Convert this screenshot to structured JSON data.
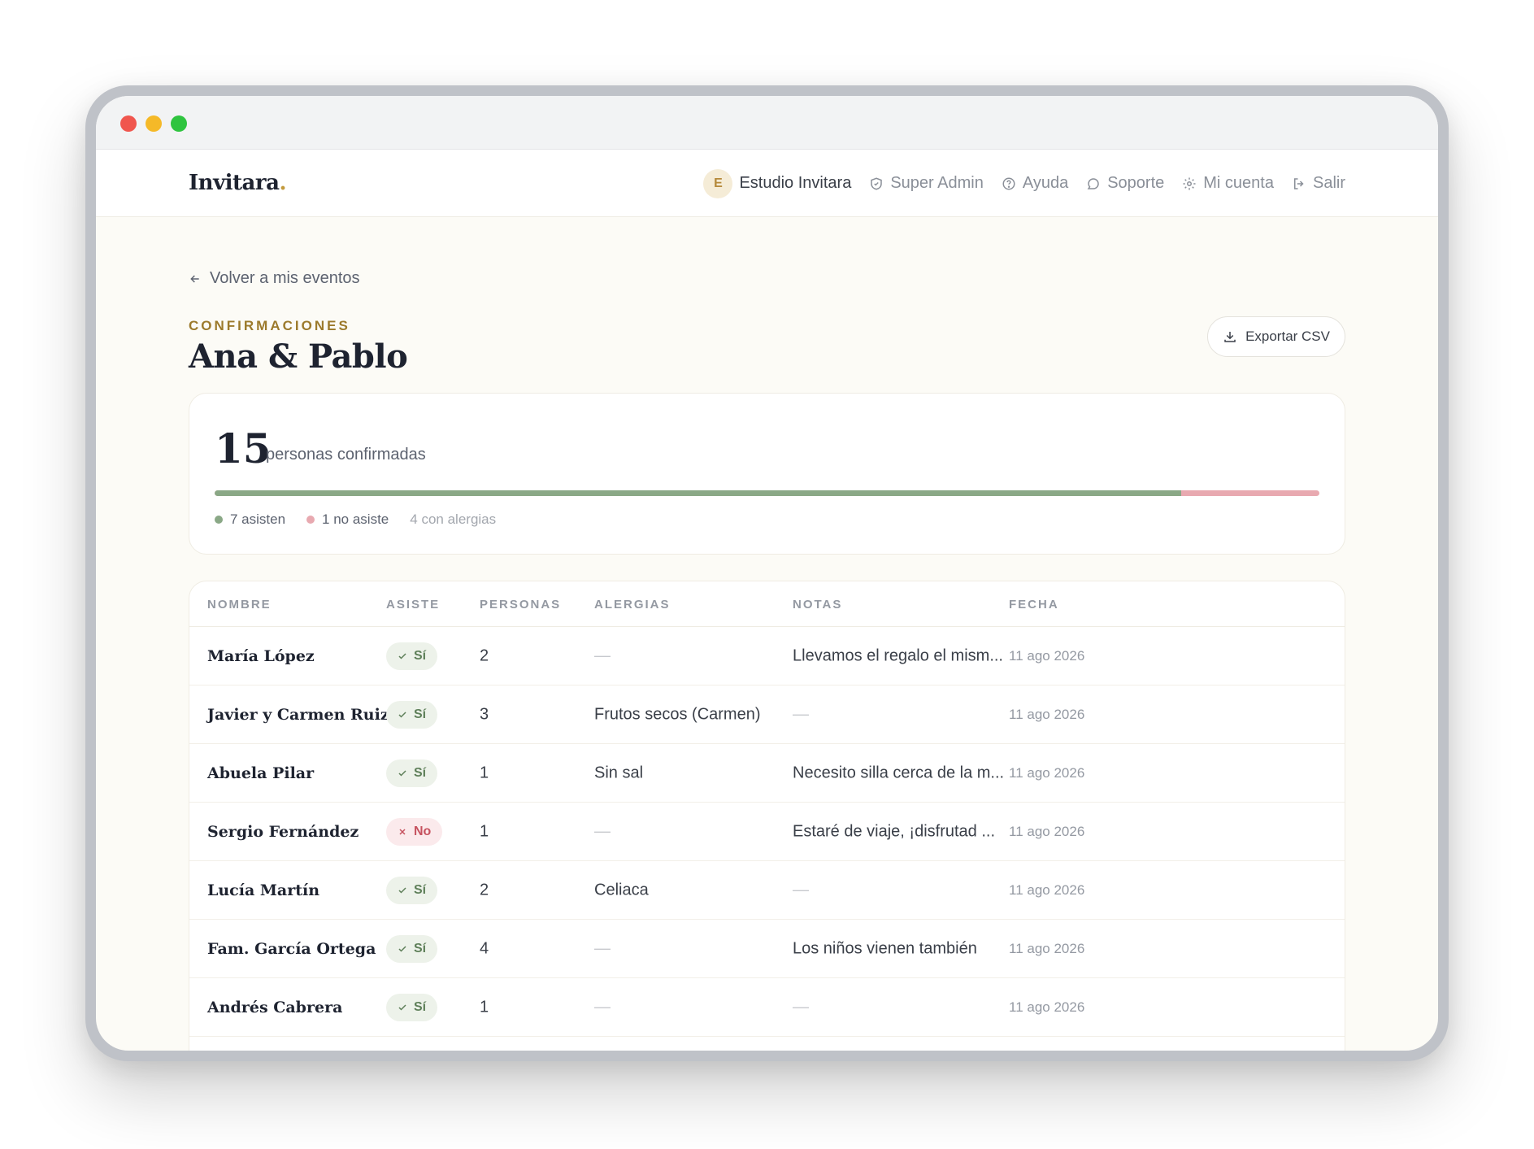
{
  "brand": {
    "name": "Invitara",
    "dot": "."
  },
  "nav": {
    "org_initial": "E",
    "org_name": "Estudio Invitara",
    "super_admin": "Super Admin",
    "help": "Ayuda",
    "support": "Soporte",
    "account": "Mi cuenta",
    "logout": "Salir"
  },
  "back_label": "Volver a mis eventos",
  "eyebrow": "CONFIRMACIONES",
  "event_title": "Ana & Pablo",
  "export_label": "Exportar CSV",
  "summary": {
    "count": "15",
    "count_label": "personas confirmadas",
    "attending_fraction": 0.875,
    "attending": "7 asisten",
    "not_attending": "1 no asiste",
    "allergies": "4 con alergias"
  },
  "table": {
    "headers": [
      "NOMBRE",
      "ASISTE",
      "PERSONAS",
      "ALERGIAS",
      "NOTAS",
      "FECHA"
    ],
    "rows": [
      {
        "name": "María López",
        "attends": "Sí",
        "yes": true,
        "people": "2",
        "allergies": "—",
        "notes": "Llevamos el regalo el mism...",
        "date": "11 ago 2026"
      },
      {
        "name": "Javier y Carmen Ruiz",
        "attends": "Sí",
        "yes": true,
        "people": "3",
        "allergies": "Frutos secos (Carmen)",
        "notes": "—",
        "date": "11 ago 2026"
      },
      {
        "name": "Abuela Pilar",
        "attends": "Sí",
        "yes": true,
        "people": "1",
        "allergies": "Sin sal",
        "notes": "Necesito silla cerca de la m...",
        "date": "11 ago 2026"
      },
      {
        "name": "Sergio Fernández",
        "attends": "No",
        "yes": false,
        "people": "1",
        "allergies": "—",
        "notes": "Estaré de viaje, ¡disfrutad ...",
        "date": "11 ago 2026"
      },
      {
        "name": "Lucía Martín",
        "attends": "Sí",
        "yes": true,
        "people": "2",
        "allergies": "Celiaca",
        "notes": "—",
        "date": "11 ago 2026"
      },
      {
        "name": "Fam. García Ortega",
        "attends": "Sí",
        "yes": true,
        "people": "4",
        "allergies": "—",
        "notes": "Los niños vienen también",
        "date": "11 ago 2026"
      },
      {
        "name": "Andrés Cabrera",
        "attends": "Sí",
        "yes": true,
        "people": "1",
        "allergies": "—",
        "notes": "—",
        "date": "11 ago 2026"
      }
    ]
  },
  "colors": {
    "accent": "#9c7a2c",
    "attending": "#8aa886",
    "not_attending": "#e8a9b0"
  }
}
